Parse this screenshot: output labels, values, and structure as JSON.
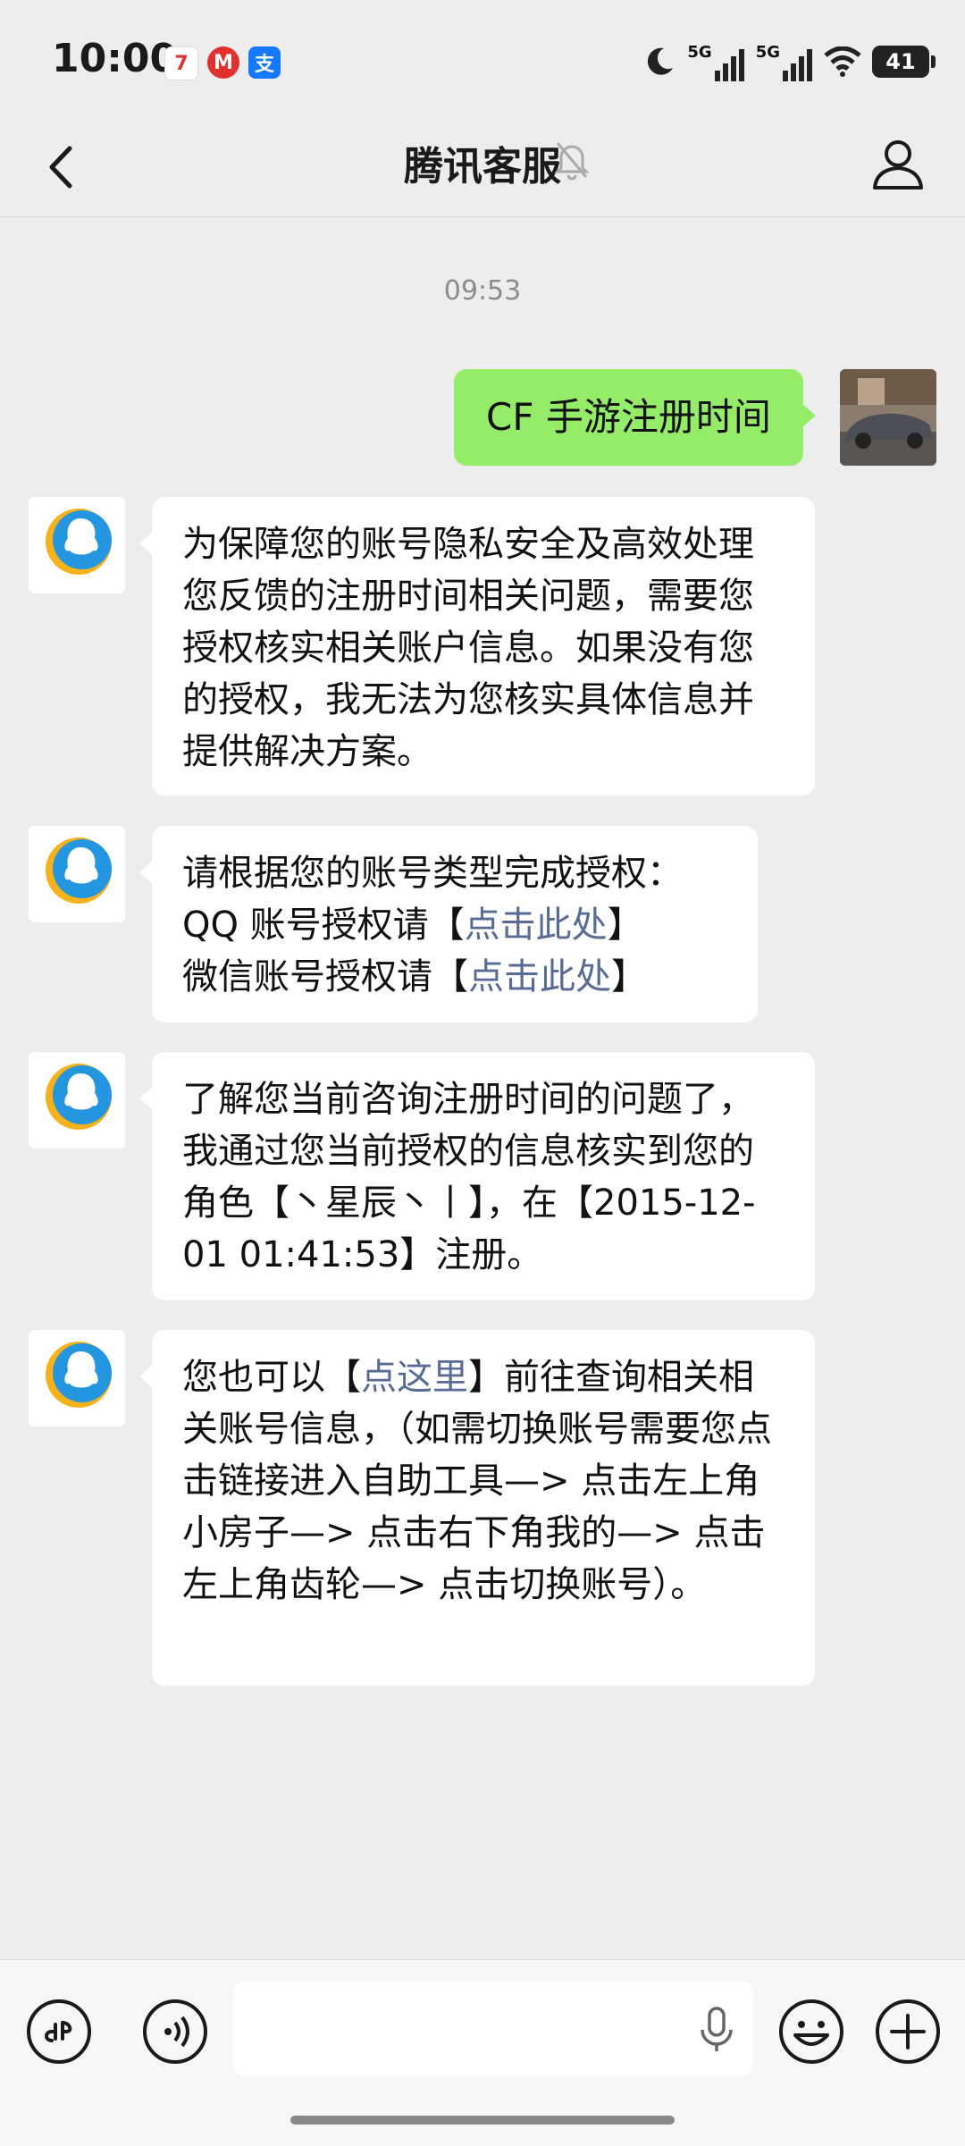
{
  "status_bar": {
    "time": "10:00",
    "app_icons": [
      "7",
      "M",
      "支"
    ],
    "signal_labels": [
      "5G",
      "5G"
    ],
    "battery": "41"
  },
  "nav": {
    "title": "腾讯客服",
    "icons": [
      "back-icon",
      "mute-bell-icon",
      "profile-icon"
    ]
  },
  "chat": {
    "timestamp": "09:53",
    "user_message": "CF 手游注册时间",
    "bot_messages": [
      {
        "text": "为保障您的账号隐私安全及高效处理您反馈的注册时间相关问题，需要您授权核实相关账户信息。如果没有您的授权，我无法为您核实具体信息并提供解决方案。"
      },
      {
        "line1": "请根据您的账号类型完成授权：",
        "line2_prefix": "QQ 账号授权请【",
        "line2_link": "点击此处",
        "line2_suffix": "】",
        "line3_prefix": "微信账号授权请【",
        "line3_link": "点击此处",
        "line3_suffix": "】"
      },
      {
        "text": "了解您当前咨询注册时间的问题了，我通过您当前授权的信息核实到您的角色【丶星辰丶丨】，在【2015-12-01 01:41:53】注册。"
      },
      {
        "prefix": "您也可以【",
        "link": "点这里",
        "suffix": "】前往查询相关相关账号信息，（如需切换账号需要您点击链接进入自助工具—> 点击左上角小房子—> 点击右下角我的—> 点击左上角齿轮—> 点击切换账号）。"
      }
    ]
  },
  "input_bar": {
    "icons": [
      "mini-program-icon",
      "voice-icon",
      "mic-icon",
      "emoji-icon",
      "plus-icon"
    ],
    "placeholder": ""
  },
  "colors": {
    "background": "#ededed",
    "user_bubble": "#95ec69",
    "link": "#576b95"
  }
}
